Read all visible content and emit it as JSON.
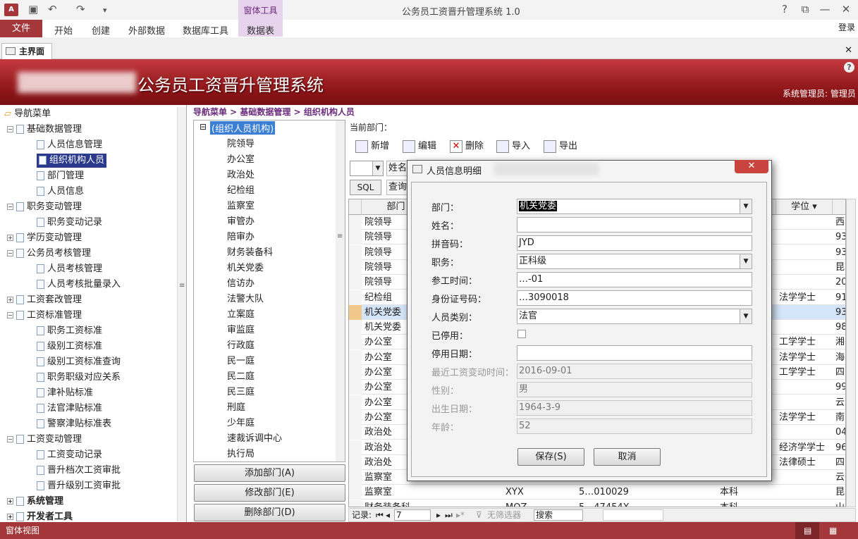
{
  "window": {
    "title": "公务员工资晋升管理系统 1.0",
    "app_icon": "A",
    "qat_save": "save-icon",
    "qat_undo": "↶",
    "qat_redo": "↷",
    "qat_more": "▾",
    "help": "?",
    "min": "—",
    "max": "☐",
    "close": "✕",
    "restore": "⧉"
  },
  "ribbon": {
    "context_group": "窗体工具",
    "file": "文件",
    "tabs": [
      "开始",
      "创建",
      "外部数据",
      "数据库工具",
      "数据表"
    ],
    "login": "登录"
  },
  "doc_tabs": {
    "main": "主界面",
    "close": "✕"
  },
  "banner": {
    "title": "公务员工资晋升管理系统",
    "admin": "系统管理员: 管理员",
    "help": "?"
  },
  "nav": {
    "root": "导航菜单",
    "items": [
      {
        "label": "基础数据管理",
        "level": 1,
        "exp": "⊟"
      },
      {
        "label": "人员信息管理",
        "level": 2
      },
      {
        "label": "组织机构人员",
        "level": 2,
        "selected": true
      },
      {
        "label": "部门管理",
        "level": 2
      },
      {
        "label": "人员信息",
        "level": 2
      },
      {
        "label": "职务变动管理",
        "level": 1,
        "exp": "⊟"
      },
      {
        "label": "职务变动记录",
        "level": 2
      },
      {
        "label": "学历变动管理",
        "level": 1,
        "exp": "⊞"
      },
      {
        "label": "公务员考核管理",
        "level": 1,
        "exp": "⊟"
      },
      {
        "label": "人员考核管理",
        "level": 2
      },
      {
        "label": "人员考核批量录入",
        "level": 2
      },
      {
        "label": "工资套改管理",
        "level": 1,
        "exp": "⊞"
      },
      {
        "label": "工资标准管理",
        "level": 1,
        "exp": "⊟"
      },
      {
        "label": "职务工资标准",
        "level": 2
      },
      {
        "label": "级别工资标准",
        "level": 2
      },
      {
        "label": "级别工资标准查询",
        "level": 2
      },
      {
        "label": "职务职级对应关系",
        "level": 2
      },
      {
        "label": "津补贴标准",
        "level": 2
      },
      {
        "label": "法官津贴标准",
        "level": 2
      },
      {
        "label": "警察津贴标准表",
        "level": 2
      },
      {
        "label": "工资变动管理",
        "level": 1,
        "exp": "⊟"
      },
      {
        "label": "工资变动记录",
        "level": 2
      },
      {
        "label": "晋升档次工资审批",
        "level": 2
      },
      {
        "label": "晋升级别工资审批",
        "level": 2
      },
      {
        "label": "系统管理",
        "level": 1,
        "exp": "⊞",
        "bold": true
      },
      {
        "label": "开发者工具",
        "level": 1,
        "exp": "⊞",
        "bold": true
      }
    ]
  },
  "breadcrumb": "导航菜单 > 基础数据管理 > 组织机构人员",
  "org_tree": {
    "root": "(组织人员机构)",
    "items": [
      "院领导",
      "办公室",
      "政治处",
      "纪检组",
      "监察室",
      "审管办",
      "陪审办",
      "财务装备科",
      "机关党委",
      "信访办",
      "法警大队",
      "立案庭",
      "审监庭",
      "行政庭",
      "民一庭",
      "民二庭",
      "民三庭",
      "刑庭",
      "少年庭",
      "速裁诉调中心",
      "执行局"
    ]
  },
  "org_buttons": [
    "添加部门(A)",
    "修改部门(E)",
    "删除部门(D)"
  ],
  "current_dept_label": "当前部门：",
  "toolbar": [
    "新增",
    "编辑",
    "删除",
    "导入",
    "导出"
  ],
  "filter": {
    "name_label": "姓名",
    "sql": "SQL",
    "query_label": "查询"
  },
  "grid": {
    "headers": [
      "部门",
      "学位"
    ],
    "rows": [
      {
        "dept": "院领导",
        "c1": "",
        "c2": "",
        "c3": "",
        "edu": "",
        "degree": "",
        "tail": "西"
      },
      {
        "dept": "院领导",
        "c1": "",
        "c2": "",
        "c3": "",
        "edu": "",
        "degree": "",
        "tail": "93"
      },
      {
        "dept": "院领导",
        "c1": "",
        "c2": "",
        "c3": "",
        "edu": "",
        "degree": "",
        "tail": "93"
      },
      {
        "dept": "院领导",
        "c1": "",
        "c2": "",
        "c3": "",
        "edu": "",
        "degree": "",
        "tail": "昆"
      },
      {
        "dept": "院领导",
        "c1": "",
        "c2": "",
        "c3": "",
        "edu": "",
        "degree": "",
        "tail": "20"
      },
      {
        "dept": "纪检组",
        "c1": "",
        "c2": "",
        "c3": "",
        "edu": "",
        "degree": "法学学士",
        "tail": "91"
      },
      {
        "dept": "机关党委",
        "c1": "",
        "c2": "",
        "c3": "",
        "edu": "",
        "degree": "",
        "tail": "93",
        "current": true
      },
      {
        "dept": "机关党委",
        "c1": "",
        "c2": "",
        "c3": "",
        "edu": "",
        "degree": "",
        "tail": "98"
      },
      {
        "dept": "办公室",
        "c1": "",
        "c2": "",
        "c3": "",
        "edu": "",
        "degree": "工学学士",
        "tail": "湘"
      },
      {
        "dept": "办公室",
        "c1": "",
        "c2": "",
        "c3": "",
        "edu": "",
        "degree": "法学学士",
        "tail": "海"
      },
      {
        "dept": "办公室",
        "c1": "",
        "c2": "",
        "c3": "",
        "edu": "",
        "degree": "工学学士",
        "tail": "四"
      },
      {
        "dept": "办公室",
        "c1": "",
        "c2": "",
        "c3": "",
        "edu": "",
        "degree": "",
        "tail": "99"
      },
      {
        "dept": "办公室",
        "c1": "",
        "c2": "",
        "c3": "",
        "edu": "",
        "degree": "",
        "tail": "云"
      },
      {
        "dept": "办公室",
        "c1": "",
        "c2": "",
        "c3": "",
        "edu": "",
        "degree": "法学学士",
        "tail": "南"
      },
      {
        "dept": "政治处",
        "c1": "",
        "c2": "",
        "c3": "",
        "edu": "",
        "degree": "",
        "tail": "04"
      },
      {
        "dept": "政治处",
        "c1": "",
        "c2": "",
        "c3": "",
        "edu": "",
        "degree": "经济学学士",
        "tail": "96"
      },
      {
        "dept": "政治处",
        "c1": "",
        "c2": "",
        "c3": "",
        "edu": "",
        "degree": "法律硕士",
        "tail": "四"
      },
      {
        "dept": "监察室",
        "c1": "",
        "c2": "",
        "c3": "",
        "edu": "",
        "degree": "",
        "tail": "云"
      },
      {
        "dept": "监察室",
        "c1": "",
        "c2": "XYX",
        "c3": "5…010029",
        "edu": "本科",
        "degree": "",
        "tail": "昆"
      },
      {
        "dept": "财务装备科",
        "c1": "",
        "c2": "MQZ",
        "c3": "5…47454X",
        "edu": "本科",
        "degree": "",
        "tail": "山"
      }
    ]
  },
  "navbar": {
    "record_label": "记录:",
    "current": "7",
    "filter": "无筛选器",
    "search": "搜索"
  },
  "status": {
    "left": "窗体视图"
  },
  "dialog": {
    "title": "人员信息明细",
    "close": "✕",
    "fields": [
      {
        "label": "部门：",
        "value": "机关党委",
        "dropdown": true,
        "highlight": true
      },
      {
        "label": "姓名：",
        "value": ""
      },
      {
        "label": "拼音码：",
        "value": "JYD"
      },
      {
        "label": "职务：",
        "value": "正科级",
        "dropdown": true
      },
      {
        "label": "参工时间：",
        "value": "…-01"
      },
      {
        "label": "身份证号码：",
        "value": "…3090018"
      },
      {
        "label": "人员类别：",
        "value": "法官",
        "dropdown": true
      },
      {
        "label": "已停用：",
        "value": "",
        "checkbox": true
      },
      {
        "label": "停用日期：",
        "value": ""
      },
      {
        "label": "最近工资变动时间：",
        "value": "2016-09-01",
        "disabled": true
      },
      {
        "label": "性别：",
        "value": "男",
        "disabled": true
      },
      {
        "label": "出生日期：",
        "value": "1964-3-9",
        "disabled": true
      },
      {
        "label": "年龄：",
        "value": "52",
        "disabled": true
      }
    ],
    "save": "保存(S)",
    "cancel": "取消"
  }
}
